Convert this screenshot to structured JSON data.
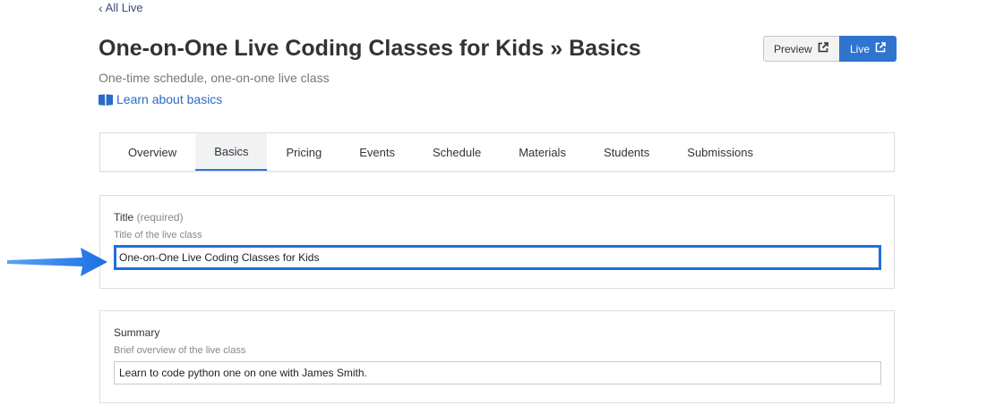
{
  "nav": {
    "back_label": "All Live"
  },
  "header": {
    "title": "One-on-One Live Coding Classes for Kids » Basics",
    "subtitle": "One-time schedule, one-on-one live class",
    "learn_link": "Learn about basics"
  },
  "actions": {
    "preview_label": "Preview",
    "live_label": "Live"
  },
  "tabs": [
    {
      "label": "Overview",
      "active": false
    },
    {
      "label": "Basics",
      "active": true
    },
    {
      "label": "Pricing",
      "active": false
    },
    {
      "label": "Events",
      "active": false
    },
    {
      "label": "Schedule",
      "active": false
    },
    {
      "label": "Materials",
      "active": false
    },
    {
      "label": "Students",
      "active": false
    },
    {
      "label": "Submissions",
      "active": false
    }
  ],
  "form": {
    "title_field": {
      "label": "Title",
      "required_note": "(required)",
      "help": "Title of the live class",
      "value": "One-on-One Live Coding Classes for Kids"
    },
    "summary_field": {
      "label": "Summary",
      "help": "Brief overview of the live class",
      "value": "Learn to code python one on one with James Smith."
    }
  },
  "colors": {
    "accent": "#2f74cf",
    "annotation_arrow": "#2b7de9",
    "focus_border": "#1f6fdc"
  },
  "icons": {
    "back": "chevron-left-icon",
    "learn": "book-open-icon",
    "external": "external-link-icon",
    "annotation": "arrow-right-icon"
  }
}
